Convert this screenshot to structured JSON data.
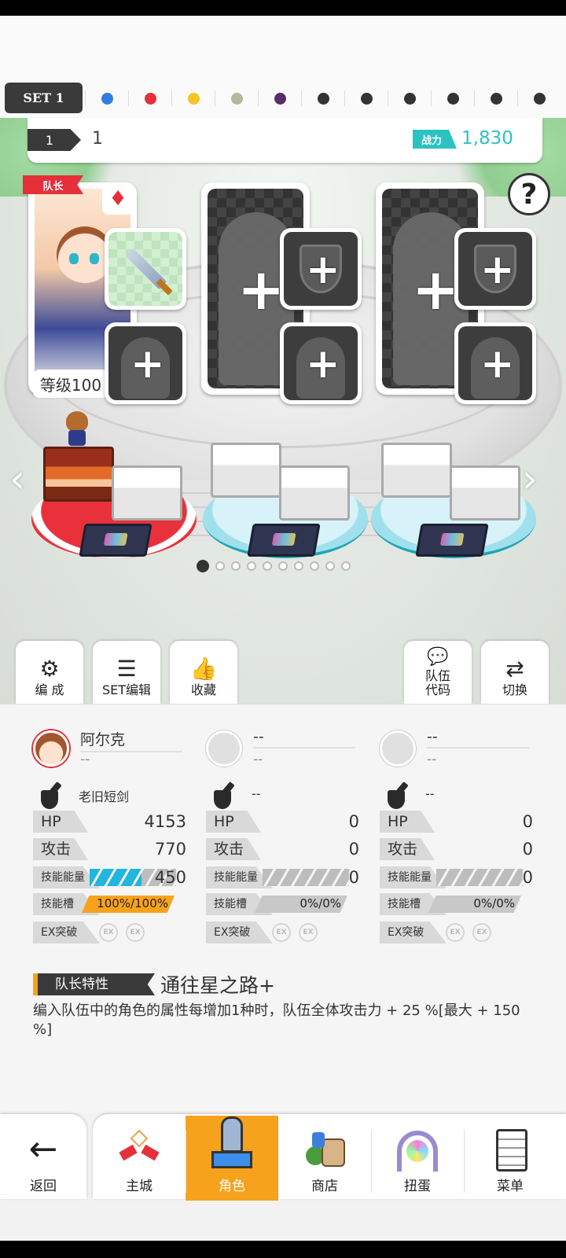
{
  "sets": {
    "active_label": "SET 1",
    "dots": [
      "#2f7de1",
      "#e5303a",
      "#f3c623",
      "#b5b89a",
      "#5a2c6b",
      "#333333",
      "#333333",
      "#333333",
      "#333333",
      "#333333",
      "#333333"
    ]
  },
  "team": {
    "number": "1",
    "name": "1",
    "power_label": "战力",
    "power_value": "1,830"
  },
  "help_icon": "?",
  "leader": {
    "badge": "队长",
    "element_icon": "♦",
    "level": "等级100"
  },
  "tools": {
    "formation": "编 成",
    "set_edit": "SET编辑",
    "favorite": "收藏",
    "team_code_1": "队伍",
    "team_code_2": "代码",
    "switch": "切换"
  },
  "colors": {
    "accent": "#f7a21c",
    "power": "#2cc2c4",
    "leader": "#e5303a",
    "energy": "#20b6e0"
  },
  "members": [
    {
      "name": "阿尔克",
      "sub": "--",
      "weapon": "老旧短剑",
      "hp_label": "HP",
      "hp": "4153",
      "atk_label": "攻击",
      "atk": "770",
      "energy_label": "技能能量",
      "energy": "450",
      "energy_fill": 0.6,
      "slot_label": "技能槽",
      "slot": "100%/100%",
      "slot_fill": 1.0,
      "ex_label": "EX突破",
      "ex1": "EX",
      "ex2": "EX"
    },
    {
      "name": "--",
      "sub": "--",
      "weapon": "--",
      "hp_label": "HP",
      "hp": "0",
      "atk_label": "攻击",
      "atk": "0",
      "energy_label": "技能能量",
      "energy": "0",
      "energy_fill": 0,
      "slot_label": "技能槽",
      "slot": "0%/0%",
      "slot_fill": 0,
      "ex_label": "EX突破",
      "ex1": "EX",
      "ex2": "EX"
    },
    {
      "name": "--",
      "sub": "--",
      "weapon": "--",
      "hp_label": "HP",
      "hp": "0",
      "atk_label": "攻击",
      "atk": "0",
      "energy_label": "技能能量",
      "energy": "0",
      "energy_fill": 0,
      "slot_label": "技能槽",
      "slot": "0%/0%",
      "slot_fill": 0,
      "ex_label": "EX突破",
      "ex1": "EX",
      "ex2": "EX"
    }
  ],
  "trait": {
    "label": "队长特性",
    "name": "通往星之路+",
    "desc": "编入队伍中的角色的属性每增加1种时，队伍全体攻击力 + 25 %[最大 + 150 %]"
  },
  "pager": {
    "count": 10,
    "active": 0
  },
  "nav": {
    "back": "返回",
    "items": [
      "主城",
      "角色",
      "商店",
      "扭蛋",
      "菜单"
    ],
    "active": 1
  }
}
